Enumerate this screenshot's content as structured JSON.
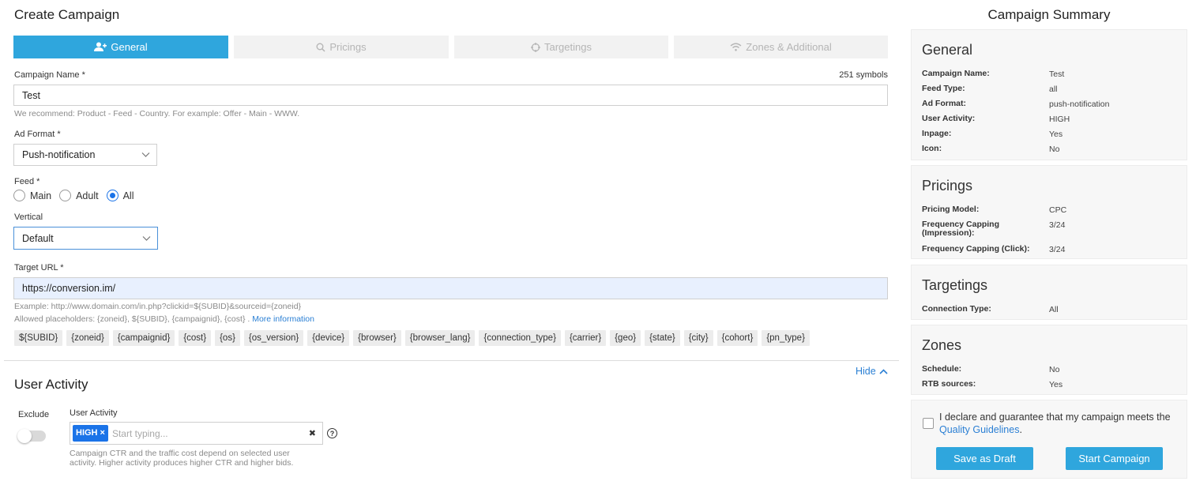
{
  "page": {
    "title": "Create Campaign"
  },
  "tabs": [
    {
      "label": "General",
      "icon": "user-add-icon",
      "active": true
    },
    {
      "label": "Pricings",
      "icon": "search-icon"
    },
    {
      "label": "Targetings",
      "icon": "target-icon"
    },
    {
      "label": "Zones & Additional",
      "icon": "wifi-icon"
    }
  ],
  "campaign_name": {
    "label": "Campaign Name *",
    "counter": "251 symbols",
    "value": "Test",
    "hint": "We recommend: Product - Feed - Country. For example: Offer - Main - WWW."
  },
  "ad_format": {
    "label": "Ad Format  *",
    "value": "Push-notification"
  },
  "feed": {
    "label": "Feed *",
    "options": [
      "Main",
      "Adult",
      "All"
    ],
    "selected": "All"
  },
  "vertical": {
    "label": "Vertical",
    "value": "Default"
  },
  "target_url": {
    "label": "Target URL  *",
    "value": "https://conversion.im/",
    "example": "Example: http://www.domain.com/in.php?clickid=${SUBID}&sourceid={zoneid}",
    "allowed": "Allowed placeholders: {zoneid}, ${SUBID}, {campaignid}, {cost} . ",
    "more_link": "More information",
    "placeholders": [
      "${SUBID}",
      "{zoneid}",
      "{campaignid}",
      "{cost}",
      "{os}",
      "{os_version}",
      "{device}",
      "{browser}",
      "{browser_lang}",
      "{connection_type}",
      "{carrier}",
      "{geo}",
      "{state}",
      "{city}",
      "{cohort}",
      "{pn_type}"
    ]
  },
  "user_activity": {
    "section_title": "User Activity",
    "hide_label": "Hide",
    "exclude_label": "Exclude",
    "exclude_on": false,
    "field_label": "User Activity",
    "tag": "HIGH",
    "tag_remove": "×",
    "placeholder": "Start typing...",
    "clear_symbol": "✖",
    "help_symbol": "?",
    "hint_line1": "Campaign CTR and the traffic cost depend on selected user",
    "hint_line2": "activity. Higher activity produces higher CTR and higher bids."
  },
  "summary": {
    "title": "Campaign Summary",
    "general": {
      "heading": "General",
      "rows": [
        {
          "k": "Campaign Name:",
          "v": "Test"
        },
        {
          "k": "Feed Type:",
          "v": "all"
        },
        {
          "k": "Ad Format:",
          "v": "push-notification"
        },
        {
          "k": "User Activity:",
          "v": "HIGH"
        },
        {
          "k": "Inpage:",
          "v": "Yes"
        },
        {
          "k": "Icon:",
          "v": "No"
        }
      ]
    },
    "pricings": {
      "heading": "Pricings",
      "rows": [
        {
          "k": "Pricing Model:",
          "v": "CPC"
        },
        {
          "k": "Frequency Capping (Impression):",
          "v": "3/24"
        },
        {
          "k": "Frequency Capping (Click):",
          "v": "3/24"
        }
      ]
    },
    "targetings": {
      "heading": "Targetings",
      "rows": [
        {
          "k": "Connection Type:",
          "v": "All"
        }
      ]
    },
    "zones": {
      "heading": "Zones",
      "rows": [
        {
          "k": "Schedule:",
          "v": "No"
        },
        {
          "k": "RTB sources:",
          "v": "Yes"
        }
      ]
    },
    "declare_text": "I declare and guarantee that my campaign meets the",
    "declare_link": "Quality Guidelines",
    "declare_end": ".",
    "save_draft": "Save as Draft",
    "start": "Start Campaign"
  },
  "colors": {
    "accent": "#2fa6dd",
    "tag": "#1a73e8",
    "link": "#2a7fd4",
    "url_bg": "#e8f0fe"
  }
}
